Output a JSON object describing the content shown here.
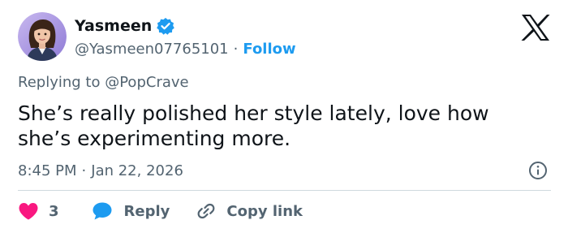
{
  "author": {
    "display_name": "Yasmeen",
    "handle": "@Yasmeen07765101",
    "separator": "·",
    "follow_label": "Follow"
  },
  "reply_context": {
    "prefix": "Replying to",
    "mention": "@PopCrave"
  },
  "tweet": {
    "text": "She’s really polished her style lately, love how she’s experimenting more.",
    "time": "8:45 PM",
    "separator": "·",
    "date": "Jan 22, 2026"
  },
  "actions": {
    "like_count": "3",
    "reply_label": "Reply",
    "copy_label": "Copy link"
  },
  "icons": {
    "verified": "verified-badge-icon",
    "brand": "x-logo-icon",
    "info": "info-icon",
    "like": "heart-icon",
    "reply": "reply-bubble-icon",
    "copy": "link-icon"
  },
  "colors": {
    "accent": "#1d9bf0",
    "like": "#f91880",
    "text": "#0f1419",
    "muted": "#536471",
    "divider": "#cfd9de"
  }
}
